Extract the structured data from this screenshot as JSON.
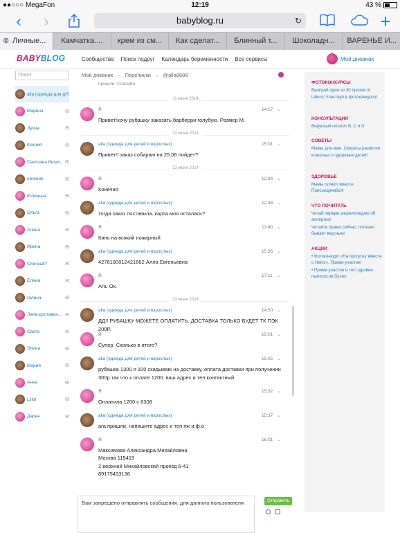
{
  "status_bar": {
    "carrier": "●●○○○ MegaFon",
    "time": "12:19",
    "battery": "43 %"
  },
  "browser": {
    "url": "babyblog.ru",
    "tabs": [
      {
        "label": "Личные..."
      },
      {
        "label": "Камчатка...."
      },
      {
        "label": "крем из см..."
      },
      {
        "label": "Как сделат..."
      },
      {
        "label": "Блинный т..."
      },
      {
        "label": "Шоколадн..."
      },
      {
        "label": "ВАРЕНЬЕ И..."
      }
    ]
  },
  "site": {
    "logo_baby": "BABY",
    "logo_blog": "BLOG",
    "nav": [
      "Сообщества",
      "Поиск подруг",
      "Календарь беременности",
      "Все сервисы"
    ],
    "my_diary": "Мой дневник"
  },
  "sidebar": {
    "search_placeholder": "Поиск",
    "contacts": [
      {
        "name": "alla (одежда для детей и взрослых)",
        "avatar": "brown",
        "active": true
      },
      {
        "name": "Марина",
        "avatar": "pink",
        "active": false
      },
      {
        "name": "Луиза",
        "avatar": "brown",
        "active": false
      },
      {
        "name": "Ксения",
        "avatar": "brown",
        "active": false
      },
      {
        "name": "Светлана Реши...",
        "avatar": "pink",
        "active": false
      },
      {
        "name": "евгения",
        "avatar": "brown",
        "active": false
      },
      {
        "name": "Юлианна",
        "avatar": "pink",
        "active": false
      },
      {
        "name": "Ольга",
        "avatar": "brown",
        "active": false
      },
      {
        "name": "Алина",
        "avatar": "pink",
        "active": false
      },
      {
        "name": "Ирина",
        "avatar": "brown",
        "active": false
      },
      {
        "name": "Олечка87",
        "avatar": "pink",
        "active": false
      },
      {
        "name": "Елена",
        "avatar": "brown",
        "active": false
      },
      {
        "name": "галина",
        "avatar": "brown",
        "active": false
      },
      {
        "name": "Лана-доставка...",
        "avatar": "pink",
        "active": false
      },
      {
        "name": "Света",
        "avatar": "pink",
        "active": false
      },
      {
        "name": "Элина",
        "avatar": "brown",
        "active": false
      },
      {
        "name": "Мария",
        "avatar": "brown",
        "active": false
      },
      {
        "name": "Анна",
        "avatar": "pink",
        "active": false
      },
      {
        "name": "Lilith",
        "avatar": "brown",
        "active": false
      },
      {
        "name": "Дарья",
        "avatar": "pink",
        "active": false
      }
    ]
  },
  "breadcrumb": [
    "Мой дневник",
    "→",
    "Переписки",
    "→",
    "@alla8888"
  ],
  "chat": {
    "partial_top": "пришли. Спасибо",
    "items": [
      {
        "kind": "date",
        "text": "11 июня 2014"
      },
      {
        "kind": "msg",
        "author": "Я",
        "time": "14:17",
        "avatar": "pink",
        "text": "Привет!хочу рубашку заказать барберри голубую. Размер М."
      },
      {
        "kind": "date",
        "text": "12 июня 2014"
      },
      {
        "kind": "msg",
        "author": "alla (одежда для детей и взрослых)",
        "time": "15:01",
        "avatar": "brown",
        "text": "Привет!! заказ собираю на 25.06 пойдет?"
      },
      {
        "kind": "date",
        "text": "13 июня 2014"
      },
      {
        "kind": "msg",
        "author": "Я",
        "time": "12:34",
        "avatar": "pink",
        "text": "Конечно"
      },
      {
        "kind": "msg",
        "author": "alla (одежда для детей и взрослых)",
        "time": "12:38",
        "avatar": "brown",
        "text": "тогда заказ поставила. карта моя осталась?"
      },
      {
        "kind": "msg",
        "author": "Я",
        "time": "13:40",
        "avatar": "pink",
        "text": "Кинь на всякий пожарный"
      },
      {
        "kind": "msg",
        "author": "alla (одежда для детей и взрослых)",
        "time": "15:36",
        "avatar": "brown",
        "text": "4276180012421862 Алла Евгеньевна"
      },
      {
        "kind": "msg",
        "author": "Я",
        "time": "17:11",
        "avatar": "pink",
        "text": "Ага. Ок."
      },
      {
        "kind": "date",
        "text": "23 июня 2014"
      },
      {
        "kind": "msg",
        "author": "alla (одежда для детей и взрослых)",
        "time": "14:50",
        "avatar": "brown",
        "text": "ДД!! РУБАШКУ МОЖЕТЕ ОПЛАТИТЬ, ДОСТАВКА ТОЛЬКО БУДЕТ ТК ПЭК 200Р."
      },
      {
        "kind": "msg",
        "author": "Я",
        "time": "15:01",
        "avatar": "pink",
        "text": "Супер. Сколько в итоге?"
      },
      {
        "kind": "msg",
        "author": "alla (одежда для детей и взрослых)",
        "time": "15:05",
        "avatar": "brown",
        "text": "рубашка 1300 я 100 скидываю на доставку, оплата доставки при получении 300р так что к оплате 1200. ваш адрес и тел контактный."
      },
      {
        "kind": "msg",
        "author": "Я",
        "time": "15:32",
        "avatar": "pink",
        "text": "Оплатила 1200 с 6308"
      },
      {
        "kind": "msg",
        "author": "alla (одежда для детей и взрослых)",
        "time": "15:37",
        "avatar": "brown",
        "text": "ага пришли. напишите адрес и теп пж и.ф.о"
      },
      {
        "kind": "msg",
        "author": "Я",
        "time": "16:01",
        "avatar": "pink",
        "text": "Максимова Александра Михайловна\nМосква 115419\n2 верхний Михайловский проезд 6-41\n89175433138"
      }
    ]
  },
  "composer": {
    "notice": "Вам запрещено отправлять сообщения, для данного пользователя",
    "send_label": "Отправить"
  },
  "right_column": [
    {
      "title": "ФОТОКОНКУРСЫ",
      "links": [
        "Выиграй один из 30 призов от Libero! Участвуй в фотоконкурсе!"
      ]
    },
    {
      "title": "КОНСУЛЬТАЦИИ",
      "links": [
        "Вирусный гепатит B, C и D"
      ]
    },
    {
      "title": "СОВЕТЫ",
      "links": [
        "Мамы для мам. Секреты развития классных и здоровых детей!"
      ]
    },
    {
      "title": "ЗДОРОВЬЕ",
      "links": [
        "Мамы гуляют вместе. Присоединяйся!"
      ]
    },
    {
      "title": "ЧТО ПОЧИТАТЬ",
      "links": [
        "Читай первую энциклопедию об аллергии!",
        "Читайте прямо сейчас: полезно бывает вкусным!"
      ]
    },
    {
      "title": "АКЦИИ",
      "links": [
        "• Фотоконкурс «На прогулку вместе с Heinz». Прими участие!",
        "• Прими участие в тест-драйве пылесосов Dyson"
      ]
    }
  ],
  "colors": {
    "accent_pink": "#e2136e",
    "link_blue": "#1d7bbf",
    "send_green": "#6cbf45"
  }
}
